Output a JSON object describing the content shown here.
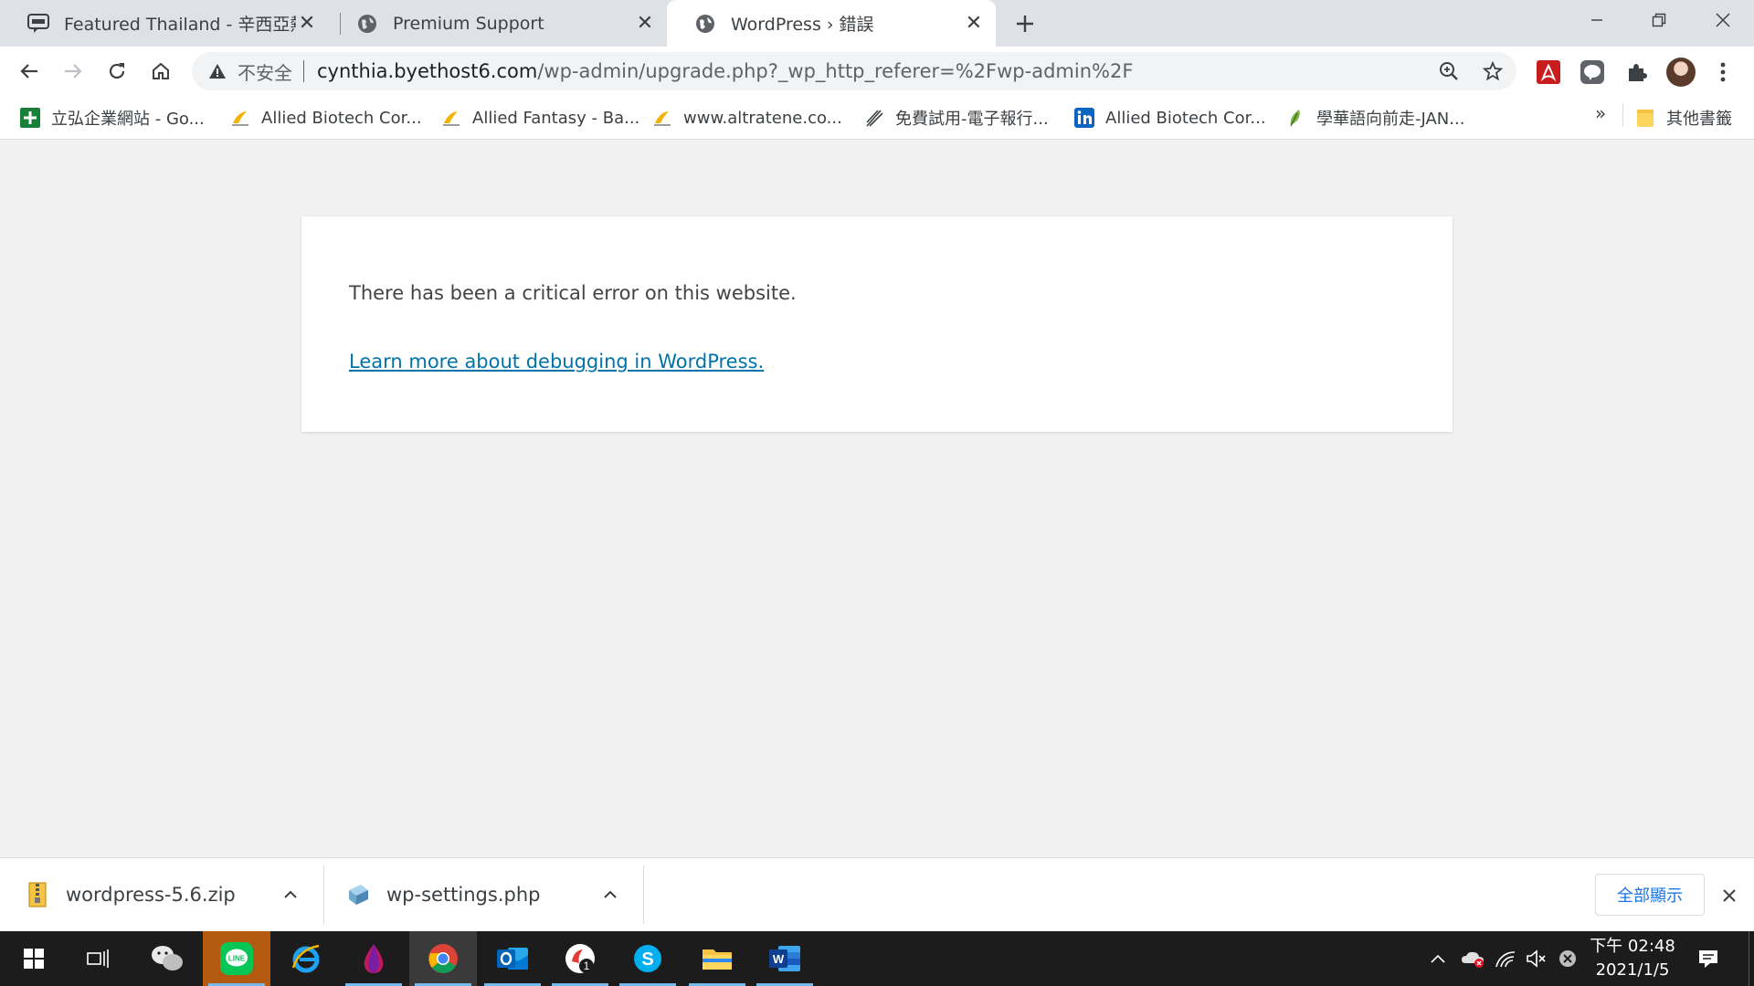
{
  "tabs": [
    {
      "title": "Featured Thailand - 辛西亞熱可",
      "favicon": "travel-logo-icon",
      "active": false
    },
    {
      "title": "Premium Support",
      "favicon": "globe-icon",
      "active": false
    },
    {
      "title": "WordPress › 錯誤",
      "favicon": "globe-icon",
      "active": true
    }
  ],
  "address_bar": {
    "security_label": "不安全",
    "url_host": "cynthia.byethost6.com",
    "url_path": "/wp-admin/upgrade.php?_wp_http_referer=%2Fwp-admin%2F"
  },
  "bookmarks": [
    {
      "label": "立弘企業網站 - Go...",
      "icon": "google-sheets-icon"
    },
    {
      "label": "Allied Biotech Cor...",
      "icon": "site-icon"
    },
    {
      "label": "Allied Fantasy - Ba...",
      "icon": "site-icon"
    },
    {
      "label": "www.altratene.co...",
      "icon": "site-icon"
    },
    {
      "label": "免費試用-電子報行...",
      "icon": "feather-icon"
    },
    {
      "label": "Allied Biotech Cor...",
      "icon": "linkedin-icon"
    },
    {
      "label": "學華語向前走-JAN...",
      "icon": "leaf-icon"
    }
  ],
  "bookmarks_more": "»",
  "other_bookmarks": "其他書籤",
  "page": {
    "message": "There has been a critical error on this website.",
    "link_text": "Learn more about debugging in WordPress."
  },
  "downloads": [
    {
      "name": "wordpress-5.6.zip",
      "icon": "zip-file-icon"
    },
    {
      "name": "wp-settings.php",
      "icon": "php-file-icon"
    }
  ],
  "show_all_label": "全部顯示",
  "taskbar": {
    "apps": [
      "start",
      "task-view",
      "wechat",
      "line",
      "internet-explorer",
      "paint-drop",
      "chrome",
      "outlook",
      "app-badge",
      "skype",
      "file-explorer",
      "word"
    ],
    "badge_count": "1",
    "clock_time": "下午 02:48",
    "clock_date": "2021/1/5"
  },
  "colors": {
    "link": "#0073aa",
    "accent": "#1a73e8",
    "taskbar": "#1c1c1c"
  }
}
